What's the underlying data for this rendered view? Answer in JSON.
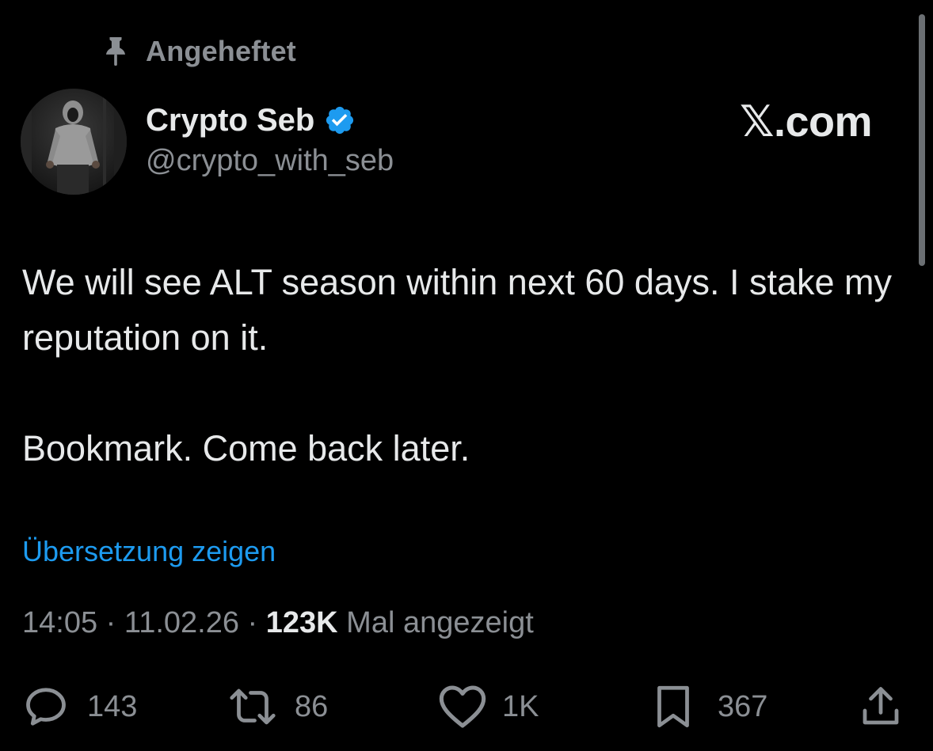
{
  "pinned": {
    "label": "Angeheftet",
    "icon": "pin-icon"
  },
  "author": {
    "display_name": "Crypto Seb",
    "handle": "@crypto_with_seb",
    "verified": true,
    "verified_icon": "verified-badge-icon"
  },
  "brand": {
    "text": "𝕏.com"
  },
  "tweet": {
    "paragraphs": [
      "We will see ALT season within next 60 days. I stake my reputation on it.",
      "Bookmark. Come back later."
    ],
    "translate_label": "Übersetzung zeigen"
  },
  "meta": {
    "time": "14:05",
    "separator": "·",
    "date": "11.02.26",
    "views_count": "123K",
    "views_label": "Mal angezeigt"
  },
  "actions": {
    "replies": {
      "icon": "reply-icon",
      "count": "143"
    },
    "reposts": {
      "icon": "repost-icon",
      "count": "86"
    },
    "likes": {
      "icon": "heart-icon",
      "count": "1K"
    },
    "bookmarks": {
      "icon": "bookmark-icon",
      "count": "367"
    },
    "share": {
      "icon": "share-icon"
    }
  },
  "colors": {
    "background": "#000000",
    "text_primary": "#e7e9ea",
    "text_secondary": "#8b8f94",
    "link": "#1d9bf0",
    "verified": "#1d9bf0"
  }
}
